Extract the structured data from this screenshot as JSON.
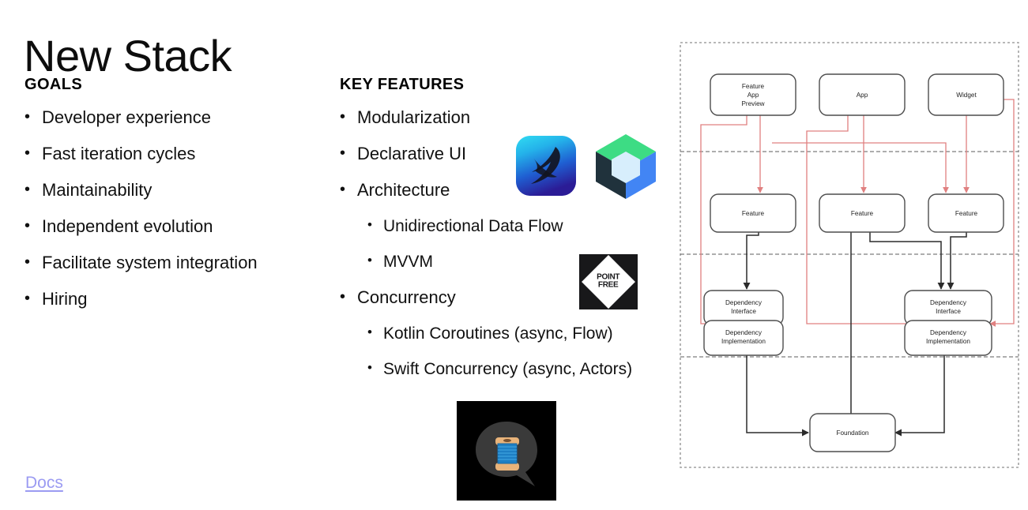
{
  "slide": {
    "title": "New Stack",
    "docs_link": "Docs"
  },
  "goals": {
    "heading": "GOALS",
    "items": [
      {
        "text": "Developer experience",
        "level": 1
      },
      {
        "text": "Fast iteration cycles",
        "level": 1
      },
      {
        "text": "Maintainability",
        "level": 1
      },
      {
        "text": "Independent evolution",
        "level": 1
      },
      {
        "text": "Facilitate system integration",
        "level": 1
      },
      {
        "text": "Hiring",
        "level": 1
      }
    ]
  },
  "key_features": {
    "heading": "KEY FEATURES",
    "items": [
      {
        "text": "Modularization",
        "level": 1
      },
      {
        "text": "Declarative UI",
        "level": 1
      },
      {
        "text": "Architecture",
        "level": 1
      },
      {
        "text": "Unidirectional Data Flow",
        "level": 2
      },
      {
        "text": "MVVM",
        "level": 2
      },
      {
        "text": "Concurrency",
        "level": 1
      },
      {
        "text": "Kotlin Coroutines (async, Flow)",
        "level": 2
      },
      {
        "text": "Swift Concurrency (async, Actors)",
        "level": 2
      }
    ]
  },
  "logos": [
    {
      "name": "swiftui-logo",
      "label": "SwiftUI"
    },
    {
      "name": "jetpack-compose-logo",
      "label": "Jetpack Compose"
    },
    {
      "name": "point-free-logo",
      "label": "POINT\nFREE"
    },
    {
      "name": "kotlin-coroutines-logo",
      "label": "Kotlin Coroutines"
    }
  ],
  "diagram": {
    "name": "architecture-layers-diagram",
    "layers": [
      {
        "id": "app-layer",
        "label": ""
      },
      {
        "id": "feature-layer",
        "label": ""
      },
      {
        "id": "dependency-layer",
        "label": ""
      },
      {
        "id": "foundation-layer",
        "label": ""
      }
    ],
    "nodes": [
      {
        "id": "feature-app-preview",
        "label": "Feature\nApp\nPreview",
        "lines": [
          "Feature",
          "App",
          "Preview"
        ]
      },
      {
        "id": "app",
        "label": "App",
        "lines": [
          "App"
        ]
      },
      {
        "id": "widget",
        "label": "Widget",
        "lines": [
          "Widget"
        ]
      },
      {
        "id": "feature-1",
        "label": "Feature",
        "lines": [
          "Feature"
        ]
      },
      {
        "id": "feature-2",
        "label": "Feature",
        "lines": [
          "Feature"
        ]
      },
      {
        "id": "feature-3",
        "label": "Feature",
        "lines": [
          "Feature"
        ]
      },
      {
        "id": "dependency-interface-1",
        "label": "Dependency\nInterface",
        "lines": [
          "Dependency",
          "Interface"
        ]
      },
      {
        "id": "dependency-implementation-1",
        "label": "Dependency\nImplementation",
        "lines": [
          "Dependency",
          "Implementation"
        ]
      },
      {
        "id": "dependency-interface-2",
        "label": "Dependency\nInterface",
        "lines": [
          "Dependency",
          "Interface"
        ]
      },
      {
        "id": "dependency-implementation-2",
        "label": "Dependency\nImplementation",
        "lines": [
          "Dependency",
          "Implementation"
        ]
      },
      {
        "id": "foundation",
        "label": "Foundation",
        "lines": [
          "Foundation"
        ]
      }
    ],
    "edge_colors": {
      "dependency": "#2b2b2b",
      "injection": "#e08080"
    }
  },
  "colors": {
    "text": "#111111",
    "link": "#9b9bf2",
    "diagram_stroke": "#4d4d4d",
    "diagram_red": "#e08080",
    "diagram_dashed": "#888888"
  }
}
